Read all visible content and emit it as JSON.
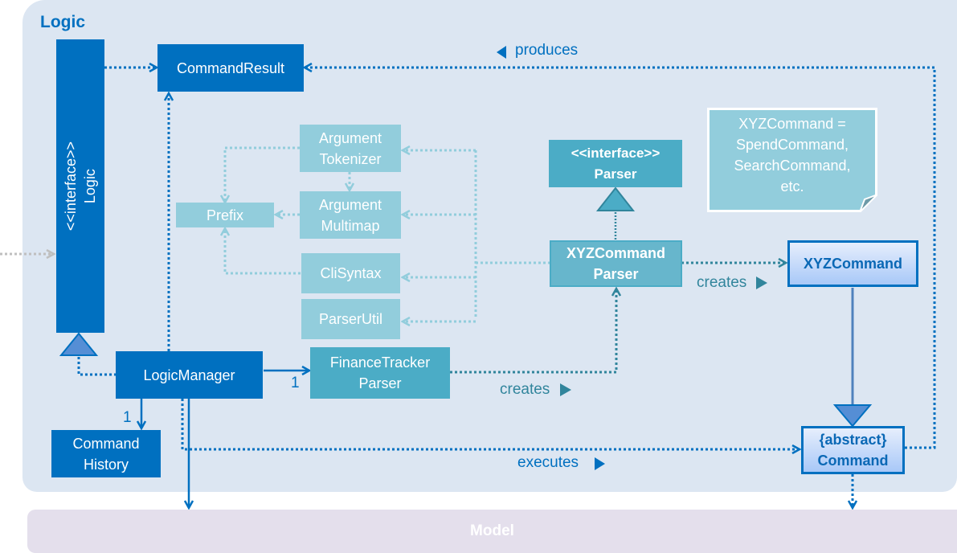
{
  "frames": {
    "logic_title": "Logic",
    "model_title": "Model"
  },
  "classes": {
    "logic_interface": {
      "stereotype": "<<interface>>",
      "name": "Logic"
    },
    "command_result": {
      "name": "CommandResult"
    },
    "argument_tokenizer": {
      "line1": "Argument",
      "line2": "Tokenizer"
    },
    "argument_multimap": {
      "line1": "Argument",
      "line2": "Multimap"
    },
    "prefix": {
      "name": "Prefix"
    },
    "cli_syntax": {
      "name": "CliSyntax"
    },
    "parser_util": {
      "name": "ParserUtil"
    },
    "parser_interface": {
      "stereotype": "<<interface>>",
      "name": "Parser"
    },
    "xyz_command_parser": {
      "line1": "XYZCommand",
      "line2": "Parser"
    },
    "xyz_command": {
      "name": "XYZCommand"
    },
    "logic_manager": {
      "name": "LogicManager"
    },
    "finance_tracker_parser": {
      "line1": "FinanceTracker",
      "line2": "Parser"
    },
    "command_history": {
      "line1": "Command",
      "line2": "History"
    },
    "abstract_command": {
      "stereotype": "{abstract}",
      "name": "Command"
    }
  },
  "note": {
    "lines": [
      "XYZCommand =",
      "SpendCommand,",
      "SearchCommand,",
      "etc."
    ]
  },
  "labels": {
    "produces": "produces",
    "creates_1": "creates",
    "creates_2": "creates",
    "executes": "executes",
    "mult_history": "1",
    "mult_parser": "1"
  },
  "colors": {
    "dark_blue": "#0070c0",
    "teal": "#4bacc6",
    "light_teal": "#92cddc",
    "logic_bg": "#dce6f2",
    "model_bg": "#e4dfec"
  }
}
